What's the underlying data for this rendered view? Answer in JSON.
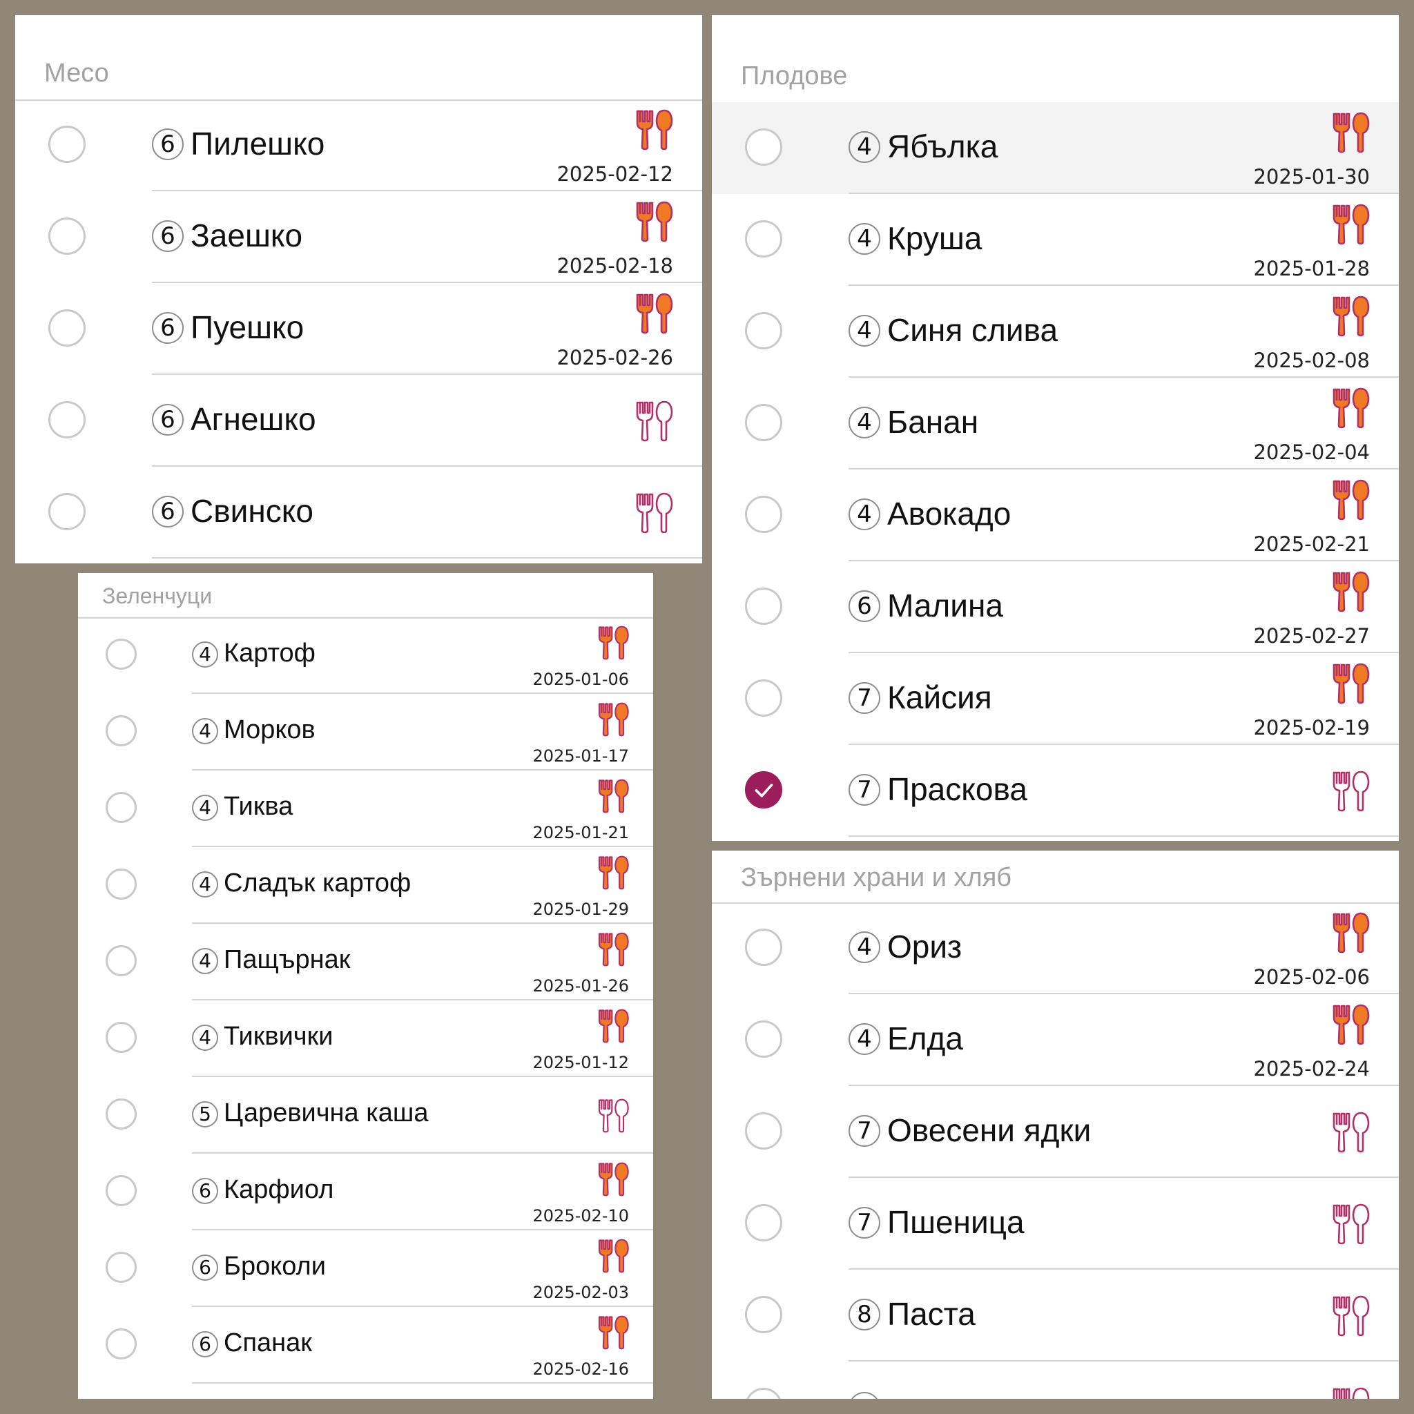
{
  "colors": {
    "background": "#918779",
    "accent": "#9c1d5c",
    "icon_filled": "#f07a24",
    "icon_outline": "#b0306a",
    "header_text": "#a2a2a2"
  },
  "icons": {
    "filled": "fork-spoon-filled-icon",
    "outline": "fork-spoon-outline-icon",
    "check": "check-icon"
  },
  "panels": [
    {
      "id": "meso",
      "title": "Месо",
      "items": [
        {
          "num": "6",
          "name": "Пилешко",
          "date": "2025-02-12",
          "tried": true,
          "checked": false
        },
        {
          "num": "6",
          "name": "Заешко",
          "date": "2025-02-18",
          "tried": true,
          "checked": false
        },
        {
          "num": "6",
          "name": "Пуешко",
          "date": "2025-02-26",
          "tried": true,
          "checked": false
        },
        {
          "num": "6",
          "name": "Агнешко",
          "date": "",
          "tried": false,
          "checked": false
        },
        {
          "num": "6",
          "name": "Свинско",
          "date": "",
          "tried": false,
          "checked": false
        }
      ]
    },
    {
      "id": "plodove",
      "title": "Плодове",
      "items": [
        {
          "num": "4",
          "name": "Ябълка",
          "date": "2025-01-30",
          "tried": true,
          "checked": false,
          "highlight": true
        },
        {
          "num": "4",
          "name": "Круша",
          "date": "2025-01-28",
          "tried": true,
          "checked": false
        },
        {
          "num": "4",
          "name": "Синя слива",
          "date": "2025-02-08",
          "tried": true,
          "checked": false
        },
        {
          "num": "4",
          "name": "Банан",
          "date": "2025-02-04",
          "tried": true,
          "checked": false
        },
        {
          "num": "4",
          "name": "Авокадо",
          "date": "2025-02-21",
          "tried": true,
          "checked": false
        },
        {
          "num": "6",
          "name": "Малина",
          "date": "2025-02-27",
          "tried": true,
          "checked": false
        },
        {
          "num": "7",
          "name": "Кайсия",
          "date": "2025-02-19",
          "tried": true,
          "checked": false
        },
        {
          "num": "7",
          "name": "Праскова",
          "date": "",
          "tried": false,
          "checked": true
        }
      ]
    },
    {
      "id": "zelenchutsi",
      "title": "Зеленчуци",
      "items": [
        {
          "num": "4",
          "name": "Картоф",
          "date": "2025-01-06",
          "tried": true,
          "checked": false
        },
        {
          "num": "4",
          "name": "Морков",
          "date": "2025-01-17",
          "tried": true,
          "checked": false
        },
        {
          "num": "4",
          "name": "Тиква",
          "date": "2025-01-21",
          "tried": true,
          "checked": false
        },
        {
          "num": "4",
          "name": "Сладък картоф",
          "date": "2025-01-29",
          "tried": true,
          "checked": false
        },
        {
          "num": "4",
          "name": "Пащърнак",
          "date": "2025-01-26",
          "tried": true,
          "checked": false
        },
        {
          "num": "4",
          "name": "Тиквички",
          "date": "2025-01-12",
          "tried": true,
          "checked": false
        },
        {
          "num": "5",
          "name": "Царевична каша",
          "date": "",
          "tried": false,
          "checked": false
        },
        {
          "num": "6",
          "name": "Карфиол",
          "date": "2025-02-10",
          "tried": true,
          "checked": false
        },
        {
          "num": "6",
          "name": "Броколи",
          "date": "2025-02-03",
          "tried": true,
          "checked": false
        },
        {
          "num": "6",
          "name": "Спанак",
          "date": "2025-02-16",
          "tried": true,
          "checked": false
        }
      ]
    },
    {
      "id": "zarneni",
      "title": "Зърнени храни и хляб",
      "items": [
        {
          "num": "4",
          "name": "Ориз",
          "date": "2025-02-06",
          "tried": true,
          "checked": false
        },
        {
          "num": "4",
          "name": "Елда",
          "date": "2025-02-24",
          "tried": true,
          "checked": false
        },
        {
          "num": "7",
          "name": "Овесени ядки",
          "date": "",
          "tried": false,
          "checked": false
        },
        {
          "num": "7",
          "name": "Пшеница",
          "date": "",
          "tried": false,
          "checked": false
        },
        {
          "num": "8",
          "name": "Паста",
          "date": "",
          "tried": false,
          "checked": false
        },
        {
          "num": "",
          "name": "",
          "date": "",
          "tried": false,
          "checked": false,
          "partial": true
        }
      ]
    }
  ]
}
